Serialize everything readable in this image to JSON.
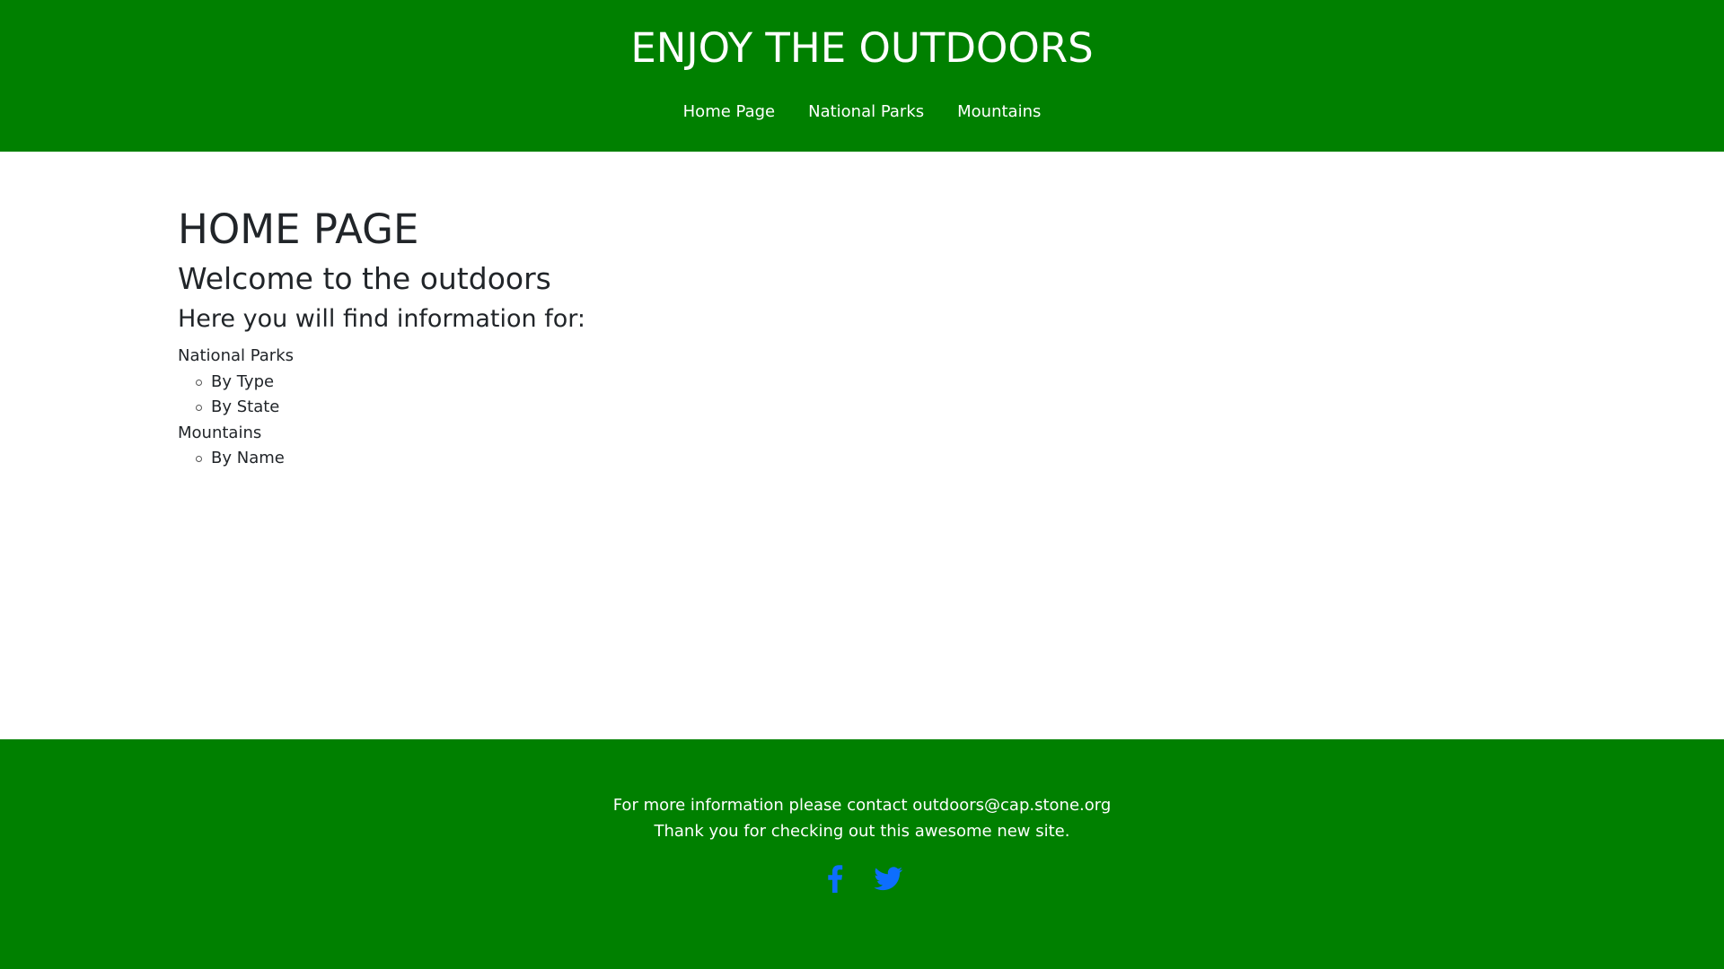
{
  "header": {
    "title": "ENJOY THE OUTDOORS",
    "nav": [
      {
        "label": "Home Page"
      },
      {
        "label": "National Parks"
      },
      {
        "label": "Mountains"
      }
    ]
  },
  "main": {
    "heading": "HOME PAGE",
    "welcome": "Welcome to the outdoors",
    "intro": "Here you will find information for:",
    "topics": [
      {
        "label": "National Parks",
        "subtopics": [
          "By Type",
          "By State"
        ]
      },
      {
        "label": "Mountains",
        "subtopics": [
          "By Name"
        ]
      }
    ]
  },
  "footer": {
    "contact": "For more information please contact outdoors@cap.stone.org",
    "thanks": "Thank you for checking out this awesome new site.",
    "social": [
      {
        "icon": "facebook-icon"
      },
      {
        "icon": "twitter-icon"
      }
    ]
  },
  "colors": {
    "brand_green": "#008000",
    "text_dark": "#212529",
    "social_blue": "#0d6efd",
    "text_light": "#ffffff"
  }
}
